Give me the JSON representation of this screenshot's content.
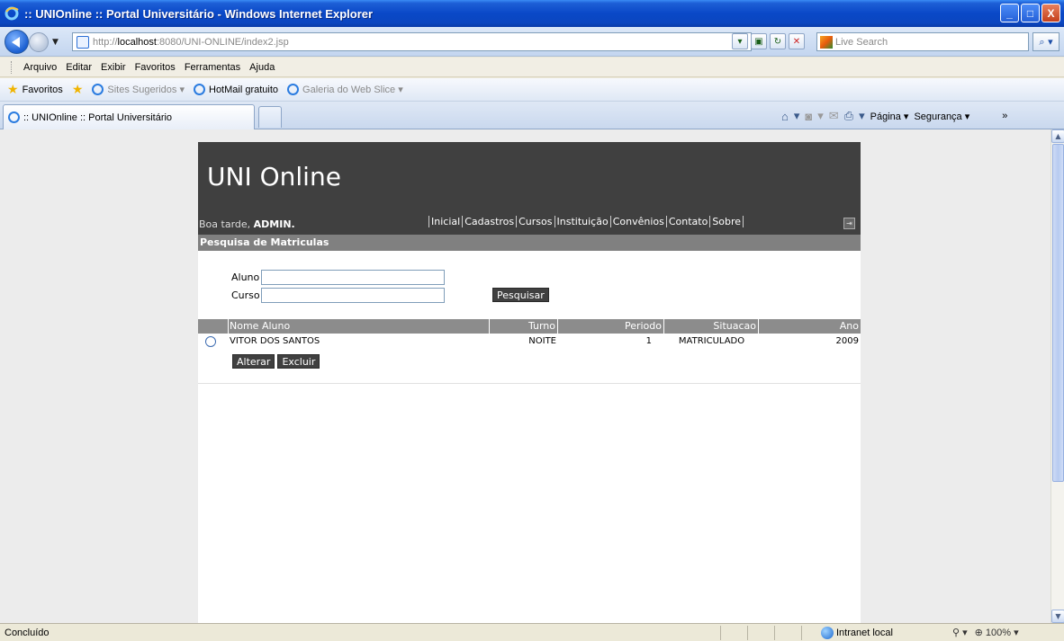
{
  "window": {
    "title": ":: UNIOnline :: Portal Universitário - Windows Internet Explorer",
    "minimize": "_",
    "maximize": "□",
    "close": "X"
  },
  "addressbar": {
    "url_prefix": "http://",
    "url_host": "localhost",
    "url_rest": ":8080/UNI-ONLINE/index2.jsp",
    "search_placeholder": "Live Search"
  },
  "menubar": {
    "items": [
      "Arquivo",
      "Editar",
      "Exibir",
      "Favoritos",
      "Ferramentas",
      "Ajuda"
    ]
  },
  "favbar": {
    "favorites": "Favoritos",
    "sites": "Sites Sugeridos ▾",
    "hotmail": "HotMail gratuito",
    "webslice": "Galeria do Web Slice ▾"
  },
  "tabs": {
    "active": ":: UNIOnline :: Portal Universitário"
  },
  "commandbar": {
    "pagina": "Página ▾",
    "seguranca": "Segurança ▾",
    "more": "»"
  },
  "page": {
    "site_title": "UNI Online",
    "greeting_prefix": "Boa tarde, ",
    "greeting_user": "ADMIN.",
    "nav": [
      "Inicial",
      "Cadastros",
      "Cursos",
      "Instituição",
      "Convênios",
      "Contato",
      "Sobre"
    ],
    "section_title": "Pesquisa de Matriculas",
    "form": {
      "aluno_label": "Aluno",
      "curso_label": "Curso",
      "aluno_value": "",
      "curso_value": "",
      "search_button": "Pesquisar"
    },
    "table": {
      "headers": [
        "Nome Aluno",
        "Turno",
        "Periodo",
        "Situacao",
        "Ano"
      ],
      "rows": [
        {
          "nome": "VITOR DOS SANTOS",
          "turno": "NOITE",
          "periodo": "1",
          "situacao": "MATRICULADO",
          "ano": "2009"
        }
      ]
    },
    "actions": {
      "alterar": "Alterar",
      "excluir": "Excluir"
    }
  },
  "statusbar": {
    "status": "Concluído",
    "zone": "Intranet local",
    "zoom": "100%"
  }
}
